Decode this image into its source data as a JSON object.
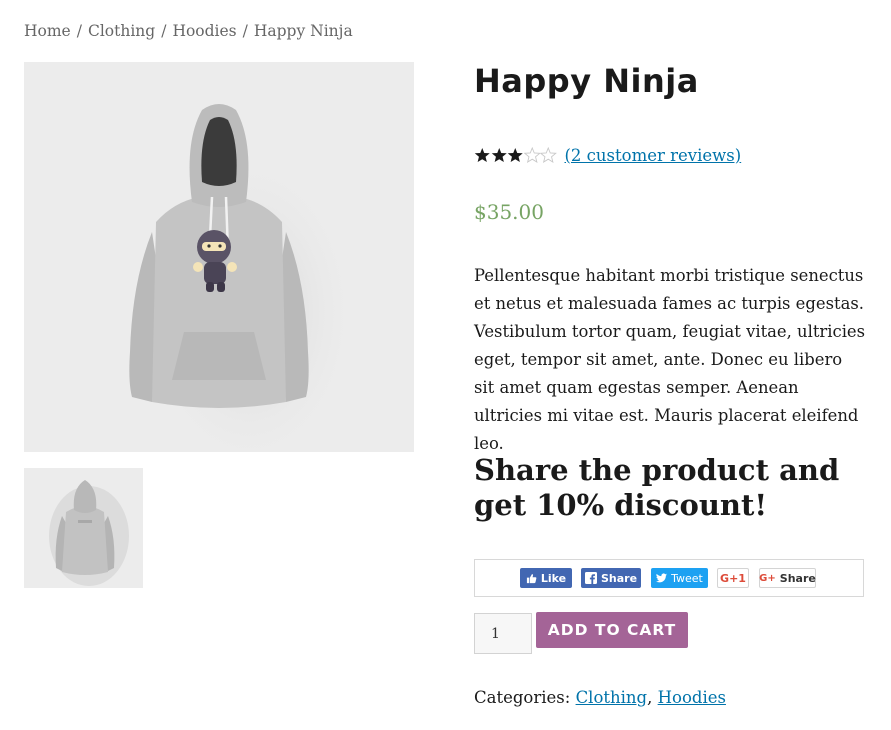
{
  "breadcrumb": {
    "items": [
      "Home",
      "Clothing",
      "Hoodies",
      "Happy Ninja"
    ],
    "separator": "/"
  },
  "product": {
    "title": "Happy Ninja",
    "rating": 3,
    "rating_max": 5,
    "reviews_link": "(2 customer reviews)",
    "price": "$35.00",
    "description": "Pellentesque habitant morbi tristique senectus et netus et malesuada fames ac turpis egestas. Vestibulum tortor quam, feugiat vitae, ultricies eget, tempor sit amet, ante. Donec eu libero sit amet quam egestas semper. Aenean ultricies mi vitae est. Mauris placerat eleifend leo."
  },
  "share": {
    "heading": "Share the product and get 10% discount!",
    "buttons": {
      "fb_like": "Like",
      "fb_share": "Share",
      "tweet": "Tweet",
      "gplus": "+1",
      "gplus_share": "Share"
    }
  },
  "cart": {
    "quantity": "1",
    "add_label": "ADD TO CART"
  },
  "categories": {
    "label": "Categories:",
    "items": [
      "Clothing",
      "Hoodies"
    ],
    "separator": ","
  },
  "colors": {
    "price": "#77a464",
    "link": "#0073aa",
    "cart_button": "#a46497",
    "facebook": "#4267b2",
    "twitter": "#1da1f2",
    "gplus": "#dd4b39"
  },
  "icons": [
    "thumbs-up-icon",
    "facebook-icon",
    "twitter-icon",
    "google-plus-icon",
    "star-icon"
  ]
}
